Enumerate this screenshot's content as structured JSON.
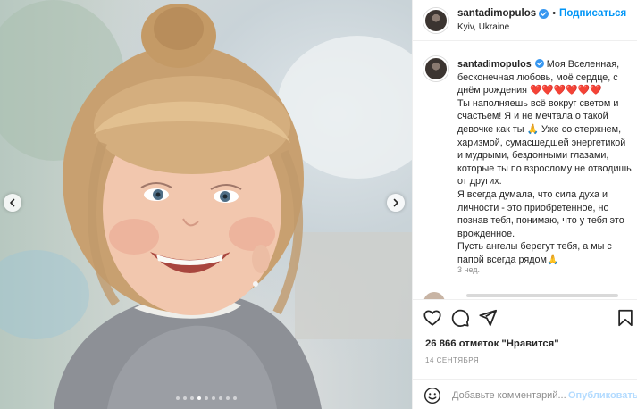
{
  "post": {
    "username": "santadimopulos",
    "follow_label": "Подписаться",
    "separator": "•",
    "location": "Kyiv, Ukraine",
    "verified_color": "#3897f0"
  },
  "caption": {
    "lines": [
      "Моя Вселенная,",
      "бесконечная любовь, моё сердце, с",
      "днём рождения ❤️❤️❤️❤️❤️❤️",
      "Ты наполняешь всё вокруг светом и",
      "счастьем! Я и не мечтала о такой",
      "девочке как ты 🙏 Уже со стержнем,",
      "харизмой, сумасшедшей энергетикой",
      "и мудрыми, бездонными глазами,",
      "которые ты по взрослому не отводишь",
      "от других.",
      "Я всегда думала, что сила духа и",
      "личности - это приобретенное, но",
      "познав тебя, понимаю, что у тебя это",
      "врожденное.",
      "Пусть ангелы берегут тебя, а мы с",
      "папой всегда рядом🙏"
    ],
    "time_ago": "3 нед."
  },
  "actions": {
    "like_icon": "heart-icon",
    "comment_icon": "comment-icon",
    "share_icon": "share-icon",
    "save_icon": "bookmark-icon"
  },
  "stats": {
    "likes": "26 866 отметок \"Нравится\"",
    "date": "14 СЕНТЯБРЯ"
  },
  "comment_box": {
    "placeholder": "Добавьте комментарий...",
    "publish_label": "Опубликовать",
    "publish_color": "#b3dbff"
  },
  "carousel": {
    "slide_count": 9,
    "active_index": 3
  }
}
